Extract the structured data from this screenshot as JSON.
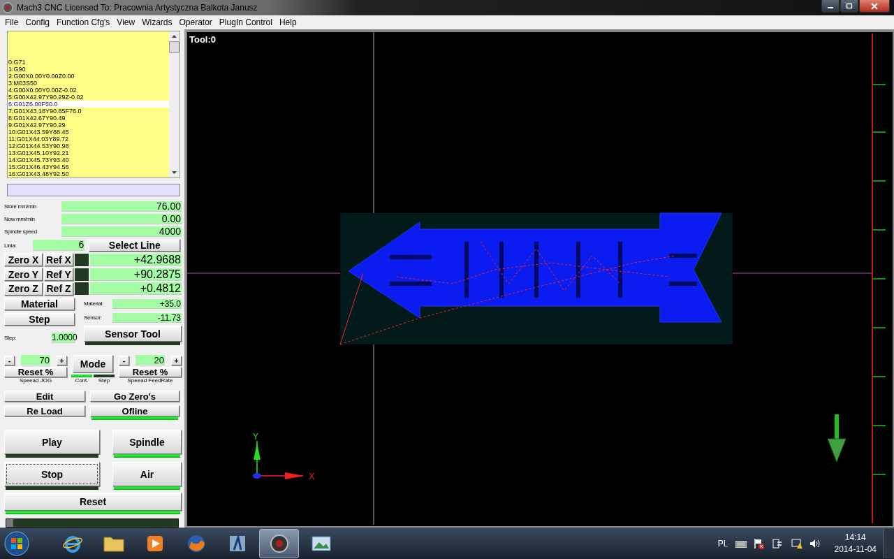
{
  "window": {
    "title": "Mach3 CNC  Licensed To: Pracownia Artystyczna Balkota Janusz"
  },
  "menu": [
    "File",
    "Config",
    "Function Cfg's",
    "View",
    "Wizards",
    "Operator",
    "PlugIn Control",
    "Help"
  ],
  "gcode": [
    {
      "text": "0:G71",
      "selected": false
    },
    {
      "text": "1:G90",
      "selected": false
    },
    {
      "text": "2:G00X0.00Y0.00Z0.00",
      "selected": false
    },
    {
      "text": "3:M03S50",
      "selected": false
    },
    {
      "text": "4:G00X0.00Y0.00Z-0.02",
      "selected": false
    },
    {
      "text": "5:G00X42.97Y90.29Z-0.02",
      "selected": false
    },
    {
      "text": "6:G01Z6.00F50.0",
      "selected": true
    },
    {
      "text": "7:G01X43.18Y90.85F76.0",
      "selected": false
    },
    {
      "text": "8:G01X42.67Y90.49",
      "selected": false
    },
    {
      "text": "9:G01X42.97Y90.29",
      "selected": false
    },
    {
      "text": "10:G01X43.59Y88.45",
      "selected": false
    },
    {
      "text": "11:G01X44.03Y89.72",
      "selected": false
    },
    {
      "text": "12:G01X44.53Y90.98",
      "selected": false
    },
    {
      "text": "13:G01X45.10Y92.21",
      "selected": false
    },
    {
      "text": "14:G01X45.73Y93.40",
      "selected": false
    },
    {
      "text": "15:G01X46.43Y94.56",
      "selected": false
    },
    {
      "text": "16:G01X43.48Y92.50",
      "selected": false
    }
  ],
  "feeds": [
    {
      "label": "Store mm/min",
      "value": "76.00"
    },
    {
      "label": "Now mm/min",
      "value": "0.00"
    },
    {
      "label": "Spindle speed",
      "value": "4000"
    }
  ],
  "line": {
    "label": "Linia:",
    "value": "6",
    "button": "Select Line"
  },
  "axes": [
    {
      "zero": "Zero X",
      "ref": "Ref X",
      "homed": false,
      "value": "+42.9688"
    },
    {
      "zero": "Zero Y",
      "ref": "Ref Y",
      "homed": false,
      "value": "+90.2875"
    },
    {
      "zero": "Zero Z",
      "ref": "Ref Z",
      "homed": false,
      "value": "+0.4812"
    }
  ],
  "material": {
    "button": "Material",
    "label": "Material:",
    "value": "+35.0"
  },
  "step": {
    "button": "Step",
    "label": "Step:",
    "value": "1.0000"
  },
  "sensor": {
    "label": "Sensor:",
    "value": "-11.73",
    "button": "Sensor Tool",
    "on": false
  },
  "jog": {
    "minus": "-",
    "value": "70",
    "plus": "+",
    "reset": "Reset  %",
    "caption": "Speead JOG"
  },
  "mode": {
    "button": "Mode",
    "leds": [
      {
        "label": "Cont.",
        "on": true
      },
      {
        "label": "Step",
        "on": false
      }
    ]
  },
  "feedrate": {
    "minus": "-",
    "value": "20",
    "plus": "+",
    "reset": "Reset  %",
    "caption": "Speead FeedRate"
  },
  "small_buttons": [
    {
      "label": "Edit",
      "kind": "plain"
    },
    {
      "label": "Go Zero's",
      "kind": "plain"
    },
    {
      "label": "Re Load",
      "kind": "plain"
    },
    {
      "label": "Ofline",
      "kind": "led",
      "on": true
    }
  ],
  "big_buttons": [
    {
      "label": "Play",
      "on": false,
      "focused": false
    },
    {
      "label": "Spindle",
      "on": true,
      "focused": false
    },
    {
      "label": "Stop",
      "on": false,
      "focused": true
    },
    {
      "label": "Air",
      "on": true,
      "focused": false
    }
  ],
  "reset": {
    "label": "Reset",
    "on": true
  },
  "progress": {
    "level": 0.04
  },
  "viewer": {
    "tool": "Tool:0",
    "axis_x": "X",
    "axis_y": "Y"
  },
  "taskbar": {
    "language": "PL",
    "time": "14:14",
    "date": "2014-11-04"
  }
}
